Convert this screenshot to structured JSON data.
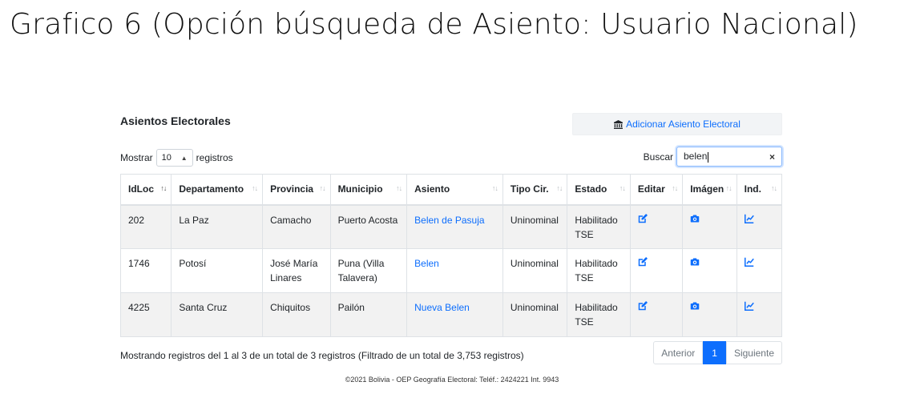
{
  "slide": {
    "title": "Grafico 6 (Opción búsqueda de Asiento: Usuario Nacional)"
  },
  "page": {
    "section_title": "Asientos Electorales",
    "add_button_label": "Adicionar Asiento Electoral"
  },
  "controls": {
    "show_label": "Mostrar",
    "page_length": "10",
    "records_label": "registros",
    "search_label": "Buscar",
    "search_value": "belen",
    "clear_symbol": "×"
  },
  "table": {
    "columns": [
      "IdLoc",
      "Departamento",
      "Provincia",
      "Municipio",
      "Asiento",
      "Tipo Cir.",
      "Estado",
      "Editar",
      "Imágen",
      "Ind."
    ],
    "rows": [
      {
        "idloc": "202",
        "departamento": "La Paz",
        "provincia": "Camacho",
        "municipio": "Puerto Acosta",
        "asiento": "Belen de Pasuja",
        "tipo": "Uninominal",
        "estado": "Habilitado TSE"
      },
      {
        "idloc": "1746",
        "departamento": "Potosí",
        "provincia": "José María Linares",
        "municipio": "Puna (Villa Talavera)",
        "asiento": "Belen",
        "tipo": "Uninominal",
        "estado": "Habilitado TSE"
      },
      {
        "idloc": "4225",
        "departamento": "Santa Cruz",
        "provincia": "Chiquitos",
        "municipio": "Pailón",
        "asiento": "Nueva Belen",
        "tipo": "Uninominal",
        "estado": "Habilitado TSE"
      }
    ],
    "row_icons": {
      "edit": "edit-icon",
      "image": "camera-icon",
      "indicator": "chart-icon"
    }
  },
  "info_text": "Mostrando registros del 1 al 3 de un total de 3 registros (Filtrado de un total de 3,753 registros)",
  "pagination": {
    "previous": "Anterior",
    "current": "1",
    "next": "Siguiente"
  },
  "footer": "©2021 Bolivia - OEP Geografía Electoral: Teléf.: 2424221 Int. 9943",
  "colors": {
    "accent": "#0d6efd",
    "row_stripe": "#f2f2f2",
    "add_button_bg": "#f2f4f6"
  }
}
